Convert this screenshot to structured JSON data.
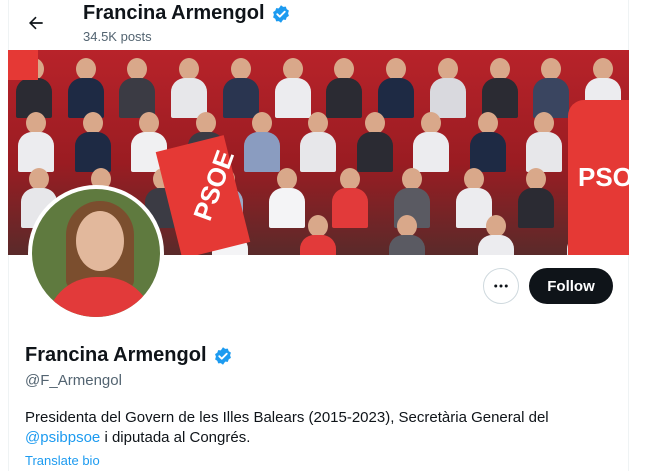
{
  "header": {
    "name": "Francina Armengol",
    "posts_count": "34.5K posts"
  },
  "banner": {
    "flag_text": "PSOE"
  },
  "actions": {
    "follow_label": "Follow"
  },
  "profile": {
    "name": "Francina Armengol",
    "handle": "@F_Armengol",
    "bio_part1": "Presidenta del Govern de les Illes Balears (2015-2023), Secretària General del ",
    "bio_mention": "@psibpsoe",
    "bio_part2": " i diputada al Congrés.",
    "translate_label": "Translate bio"
  },
  "colors": {
    "accent": "#1d9bf0",
    "follow_bg": "#0f1419",
    "banner_red": "#b8232a"
  },
  "icons": [
    "back-arrow-icon",
    "verified-badge-icon",
    "more-options-icon"
  ]
}
